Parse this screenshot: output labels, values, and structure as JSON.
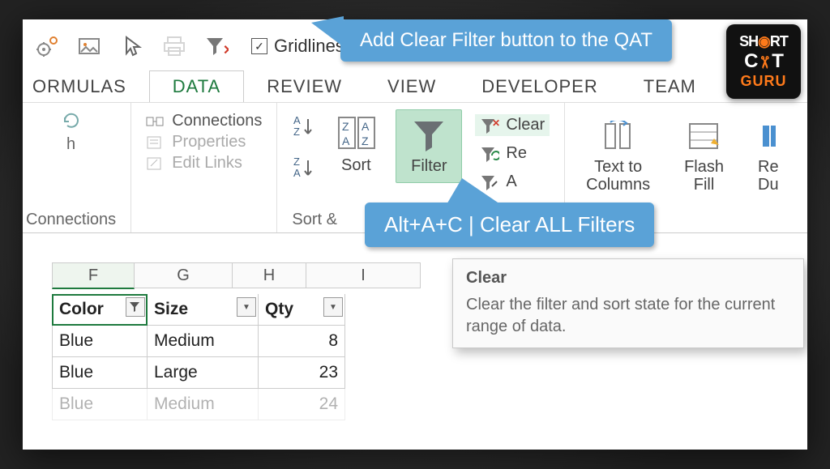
{
  "qat": {
    "gridlines": "Gridlines"
  },
  "tabs": [
    "ORMULAS",
    "DATA",
    "REVIEW",
    "VIEW",
    "DEVELOPER",
    "TEAM"
  ],
  "ribbon": {
    "refresh": "h",
    "group_connections": "Connections",
    "connections": [
      "Connections",
      "Properties",
      "Edit Links"
    ],
    "sort": "Sort",
    "filter": "Filter",
    "clear": "Clear",
    "reapply": "Re",
    "advanced": "A",
    "group_sortfilter": "Sort &",
    "text_to_columns": "Text to\nColumns",
    "flash_fill": "Flash\nFill",
    "remove_dup": "Re\nDu"
  },
  "tooltip": {
    "title": "Clear",
    "body": "Clear the filter and sort state for the current range of data."
  },
  "callouts": {
    "qat": "Add Clear Filter  button to the QAT",
    "shortcut": "Alt+A+C | Clear ALL Filters"
  },
  "sheet": {
    "cols": [
      "F",
      "G",
      "H",
      "I"
    ],
    "headers": [
      "Color",
      "Size",
      "Qty"
    ],
    "rows": [
      [
        "Blue",
        "Medium",
        "8"
      ],
      [
        "Blue",
        "Large",
        "23"
      ],
      [
        "Blue",
        "Medium",
        "24"
      ]
    ]
  }
}
